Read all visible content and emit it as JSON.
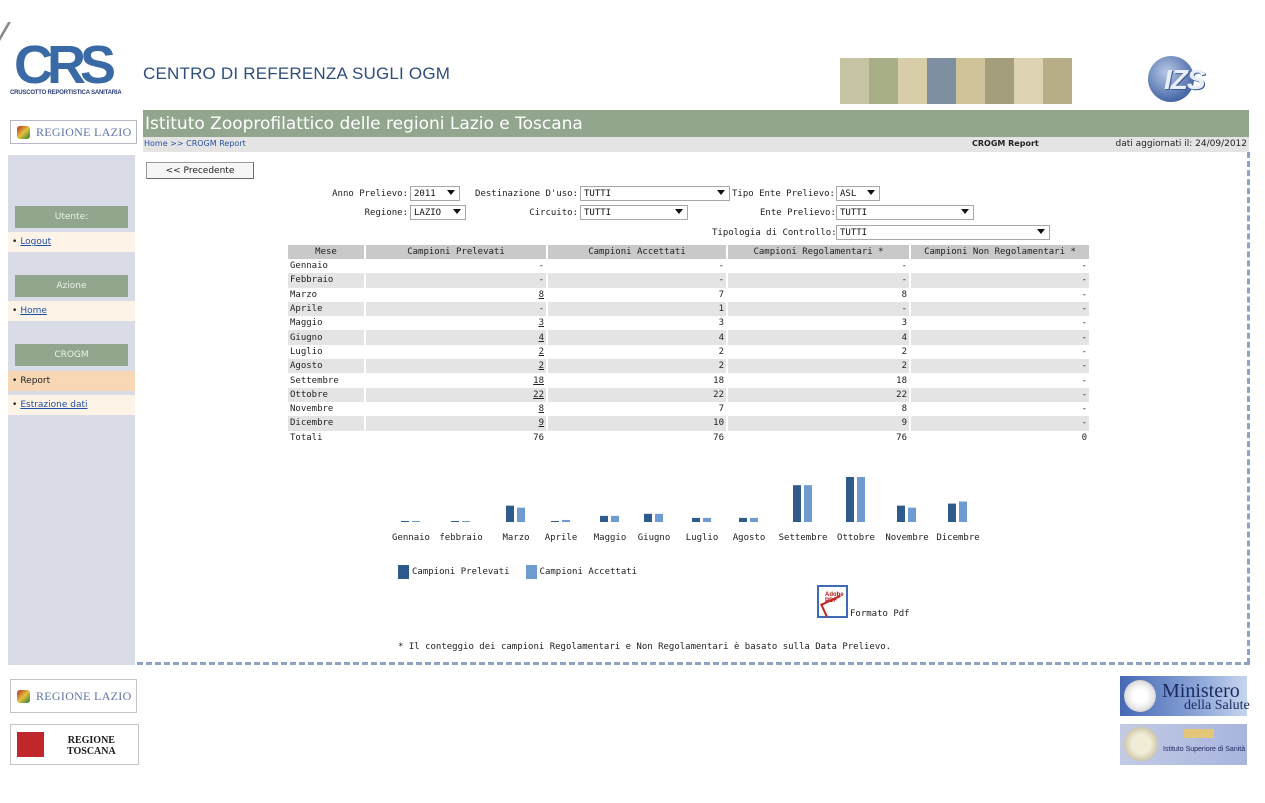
{
  "header": {
    "logo_text": "CRS",
    "logo_caption": "CRUSCOTTO REPORTISTICA SANITARIA",
    "site_title": "CENTRO DI REFERENZA SUGLI OGM",
    "izs_logo_text": "IZS"
  },
  "band": {
    "title": "Istituto Zooprofilattico delle regioni Lazio e Toscana",
    "breadcrumb": "Home >> CROGM Report",
    "report_label": "CROGM Report",
    "updated": "dati aggiornati il: 24/09/2012"
  },
  "sidebar": {
    "region_badge": "REGIONE LAZIO",
    "sections": [
      {
        "title": "Utente:",
        "items": [
          {
            "label": "Logout",
            "link": true
          }
        ]
      },
      {
        "title": "Azione",
        "items": [
          {
            "label": "Home",
            "link": true
          }
        ]
      },
      {
        "title": "CROGM",
        "items": [
          {
            "label": "Report",
            "link": false,
            "active": true
          },
          {
            "label": "Estrazione dati",
            "link": true
          }
        ]
      }
    ]
  },
  "nav": {
    "prev_label": "<< Precedente"
  },
  "filters": {
    "anno_label": "Anno Prelievo:",
    "anno_value": "2011",
    "destinazione_label": "Destinazione D'uso:",
    "destinazione_value": "TUTTI",
    "tipo_ente_label": "Tipo Ente Prelievo:",
    "tipo_ente_value": "ASL",
    "regione_label": "Regione:",
    "regione_value": "LAZIO",
    "circuito_label": "Circuito:",
    "circuito_value": "TUTTI",
    "ente_label": "Ente Prelievo:",
    "ente_value": "TUTTI",
    "tipologia_label": "Tipologia di Controllo:",
    "tipologia_value": "TUTTI"
  },
  "table": {
    "headers": [
      "Mese",
      "Campioni Prelevati",
      "Campioni Accettati",
      "Campioni Regolamentari *",
      "Campioni Non Regolamentari *"
    ],
    "rows": [
      [
        "Gennaio",
        "-",
        "-",
        "-",
        "-"
      ],
      [
        "Febbraio",
        "-",
        "-",
        "-",
        "-"
      ],
      [
        "Marzo",
        "8",
        "7",
        "8",
        "-"
      ],
      [
        "Aprile",
        "-",
        "1",
        "-",
        "-"
      ],
      [
        "Maggio",
        "3",
        "3",
        "3",
        "-"
      ],
      [
        "Giugno",
        "4",
        "4",
        "4",
        "-"
      ],
      [
        "Luglio",
        "2",
        "2",
        "2",
        "-"
      ],
      [
        "Agosto",
        "2",
        "2",
        "2",
        "-"
      ],
      [
        "Settembre",
        "18",
        "18",
        "18",
        "-"
      ],
      [
        "Ottobre",
        "22",
        "22",
        "22",
        "-"
      ],
      [
        "Novembre",
        "8",
        "7",
        "8",
        "-"
      ],
      [
        "Dicembre",
        "9",
        "10",
        "9",
        "-"
      ]
    ],
    "totals": [
      "Totali",
      "76",
      "76",
      "76",
      "0"
    ]
  },
  "chart_data": {
    "type": "bar",
    "categories": [
      "Gennaio",
      "febbraio",
      "Marzo",
      "Aprile",
      "Maggio",
      "Giugno",
      "Luglio",
      "Agosto",
      "Settembre",
      "Ottobre",
      "Novembre",
      "Dicembre"
    ],
    "series": [
      {
        "name": "Campioni Prelevati",
        "values": [
          0,
          0,
          8,
          0,
          3,
          4,
          2,
          2,
          18,
          22,
          8,
          9
        ]
      },
      {
        "name": "Campioni Accettati",
        "values": [
          0,
          0,
          7,
          1,
          3,
          4,
          2,
          2,
          18,
          22,
          7,
          10
        ]
      }
    ],
    "colors": [
      "#2f5a8c",
      "#6e9bd0"
    ],
    "legend_position": "bottom-left"
  },
  "pdf": {
    "label": "Formato Pdf",
    "icon_text": "Adobe PDF"
  },
  "footnote": "* Il conteggio dei campioni Regolamentari e Non Regolamentari è basato sulla Data Prelievo.",
  "footer": {
    "lazio": "REGIONE LAZIO",
    "toscana_line1": "REGIONE",
    "toscana_line2": "TOSCANA",
    "ministero_line1": "Ministero",
    "ministero_line2": "della Salute",
    "iss": "Istituto Superiore di Sanità"
  }
}
